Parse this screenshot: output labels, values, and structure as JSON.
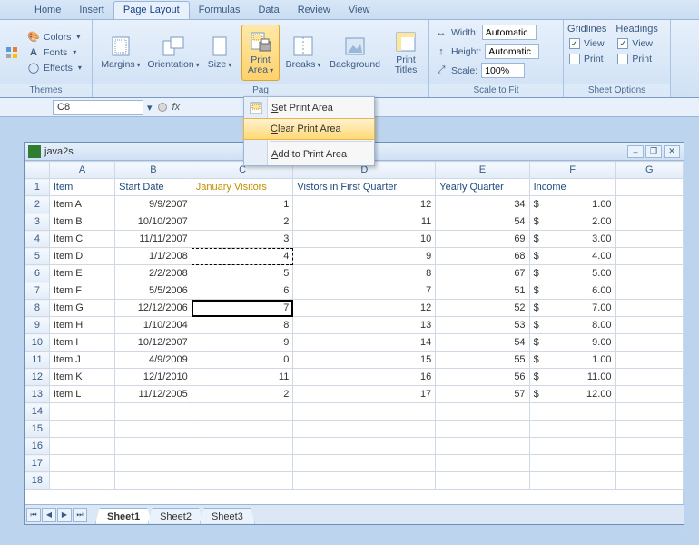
{
  "tabs": [
    "Home",
    "Insert",
    "Page Layout",
    "Formulas",
    "Data",
    "Review",
    "View"
  ],
  "active_tab": "Page Layout",
  "themes": {
    "colors": "Colors",
    "fonts": "Fonts",
    "effects": "Effects",
    "group": "Themes"
  },
  "page_setup": {
    "margins": "Margins",
    "orientation": "Orientation",
    "size": "Size",
    "print_area": "Print\nArea",
    "breaks": "Breaks",
    "background": "Background",
    "print_titles": "Print\nTitles",
    "group": "Pag"
  },
  "scale": {
    "width_lbl": "Width:",
    "height_lbl": "Height:",
    "scale_lbl": "Scale:",
    "width_val": "Automatic",
    "height_val": "Automatic",
    "scale_val": "100%",
    "group": "Scale to Fit"
  },
  "sheet_opts": {
    "gridlines": "Gridlines",
    "headings": "Headings",
    "view": "View",
    "print": "Print",
    "group": "Sheet Options"
  },
  "namebox": "C8",
  "menu": {
    "set": "Set Print Area",
    "clear": "Clear Print Area",
    "add": "Add to Print Area"
  },
  "doc_title": "java2s",
  "columns": [
    "A",
    "B",
    "C",
    "D",
    "E",
    "F",
    "G"
  ],
  "headers": [
    "Item",
    "Start Date",
    "January Visitors",
    "Vistors in First Quarter",
    "Yearly Quarter",
    "Income"
  ],
  "rows": [
    {
      "a": "Item A",
      "b": "9/9/2007",
      "c": "1",
      "d": "12",
      "e": "34",
      "f": "1.00"
    },
    {
      "a": "Item B",
      "b": "10/10/2007",
      "c": "2",
      "d": "11",
      "e": "54",
      "f": "2.00"
    },
    {
      "a": "Item C",
      "b": "11/11/2007",
      "c": "3",
      "d": "10",
      "e": "69",
      "f": "3.00"
    },
    {
      "a": "Item D",
      "b": "1/1/2008",
      "c": "4",
      "d": "9",
      "e": "68",
      "f": "4.00"
    },
    {
      "a": "Item E",
      "b": "2/2/2008",
      "c": "5",
      "d": "8",
      "e": "67",
      "f": "5.00"
    },
    {
      "a": "Item F",
      "b": "5/5/2006",
      "c": "6",
      "d": "7",
      "e": "51",
      "f": "6.00"
    },
    {
      "a": "Item G",
      "b": "12/12/2006",
      "c": "7",
      "d": "12",
      "e": "52",
      "f": "7.00"
    },
    {
      "a": "Item H",
      "b": "1/10/2004",
      "c": "8",
      "d": "13",
      "e": "53",
      "f": "8.00"
    },
    {
      "a": "Item I",
      "b": "10/12/2007",
      "c": "9",
      "d": "14",
      "e": "54",
      "f": "9.00"
    },
    {
      "a": "Item J",
      "b": "4/9/2009",
      "c": "0",
      "d": "15",
      "e": "55",
      "f": "1.00"
    },
    {
      "a": "Item K",
      "b": "12/1/2010",
      "c": "11",
      "d": "16",
      "e": "56",
      "f": "11.00"
    },
    {
      "a": "Item L",
      "b": "11/12/2005",
      "c": "2",
      "d": "17",
      "e": "57",
      "f": "12.00"
    }
  ],
  "currency": "$",
  "sheet_tabs": [
    "Sheet1",
    "Sheet2",
    "Sheet3"
  ],
  "active_sheet": "Sheet1",
  "active_cell": "C8",
  "marquee_cell": "C5"
}
